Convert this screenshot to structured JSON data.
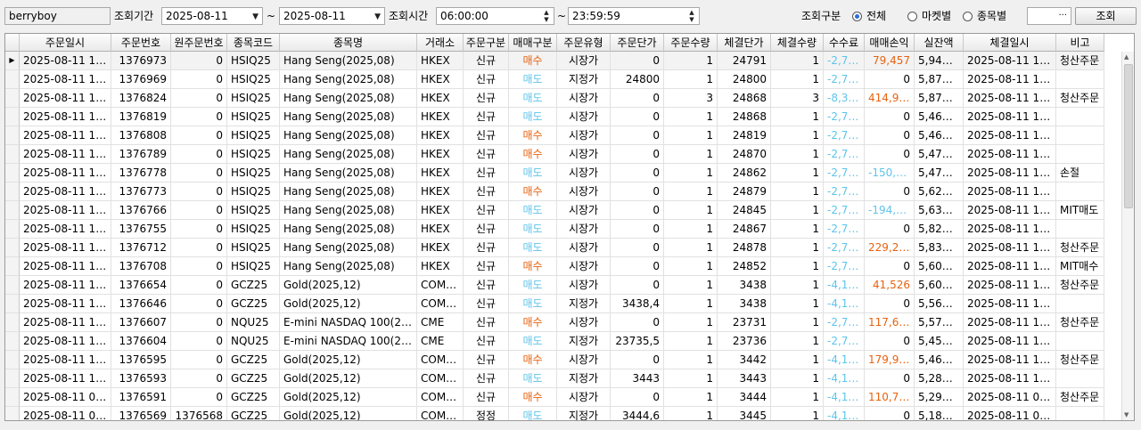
{
  "toolbar": {
    "user_id": "berryboy",
    "period_label": "조회기간",
    "date_from": "2025-08-11",
    "tilde1": "~",
    "date_to": "2025-08-11",
    "time_label": "조회시간",
    "time_from": "06:00:00",
    "tilde2": "~",
    "time_to": "23:59:59",
    "filter_label": "조회구분",
    "radio_all": "전체",
    "radio_market": "마켓별",
    "radio_symbol": "종목별",
    "ellipsis": "···",
    "search_button": "조회"
  },
  "icons": {
    "selected_row": "triangle-right-icon",
    "dropdown": "chevron-down-icon",
    "spin": "spin-updown-icon"
  },
  "colors": {
    "buy": "#e8620f",
    "sell": "#5ec4ea",
    "negative": "#5ec4ea",
    "positive": "#e8620f",
    "radio_on": "#2a6bd6"
  },
  "columns": [
    "주문일시",
    "주문번호",
    "원주문번호",
    "종목코드",
    "종목명",
    "거래소",
    "주문구분",
    "매매구분",
    "주문유형",
    "주문단가",
    "주문수량",
    "체결단가",
    "체결수량",
    "수수료",
    "매매손익",
    "실잔액",
    "체결일시",
    "비고"
  ],
  "rows": [
    [
      "2025-08-11 11:…",
      "1376973",
      "0",
      "HSIQ25",
      "Hang Seng(2025,08)",
      "HKEX",
      "신규",
      "매수",
      "시장가",
      "0",
      "1",
      "24791",
      "1",
      "-2,772",
      "79,457",
      "5,947,…",
      "2025-08-11 11:…",
      "청산주문"
    ],
    [
      "2025-08-11 11:…",
      "1376969",
      "0",
      "HSIQ25",
      "Hang Seng(2025,08)",
      "HKEX",
      "신규",
      "매도",
      "지정가",
      "24800",
      "1",
      "24800",
      "1",
      "-2,772",
      "0",
      "5,870,…",
      "2025-08-11 11:…",
      ""
    ],
    [
      "2025-08-11 10:…",
      "1376824",
      "0",
      "HSIQ25",
      "Hang Seng(2025,08)",
      "HKEX",
      "신규",
      "매도",
      "시장가",
      "0",
      "3",
      "24868",
      "3",
      "-8,316",
      "414,940",
      "5,873,…",
      "2025-08-11 10:…",
      "청산주문"
    ],
    [
      "2025-08-11 10:…",
      "1376819",
      "0",
      "HSIQ25",
      "Hang Seng(2025,08)",
      "HKEX",
      "신규",
      "매도",
      "시장가",
      "0",
      "1",
      "24868",
      "1",
      "-2,772",
      "0",
      "5,466,…",
      "2025-08-11 10:…",
      ""
    ],
    [
      "2025-08-11 10:…",
      "1376808",
      "0",
      "HSIQ25",
      "Hang Seng(2025,08)",
      "HKEX",
      "신규",
      "매수",
      "시장가",
      "0",
      "1",
      "24819",
      "1",
      "-2,772",
      "0",
      "5,469,…",
      "2025-08-11 10:…",
      ""
    ],
    [
      "2025-08-11 10:…",
      "1376789",
      "0",
      "HSIQ25",
      "Hang Seng(2025,08)",
      "HKEX",
      "신규",
      "매수",
      "시장가",
      "0",
      "1",
      "24870",
      "1",
      "-2,772",
      "0",
      "5,472,…",
      "2025-08-11 10:…",
      ""
    ],
    [
      "2025-08-11 10:…",
      "1376778",
      "0",
      "HSIQ25",
      "Hang Seng(2025,08)",
      "HKEX",
      "신규",
      "매도",
      "시장가",
      "0",
      "1",
      "24862",
      "1",
      "-2,772",
      "-150,085",
      "5,475,…",
      "2025-08-11 10:…",
      "손절"
    ],
    [
      "2025-08-11 10:…",
      "1376773",
      "0",
      "HSIQ25",
      "Hang Seng(2025,08)",
      "HKEX",
      "신규",
      "매수",
      "시장가",
      "0",
      "1",
      "24879",
      "1",
      "-2,772",
      "0",
      "5,628,…",
      "2025-08-11 10:…",
      ""
    ],
    [
      "2025-08-11 10:…",
      "1376766",
      "0",
      "HSIQ25",
      "Hang Seng(2025,08)",
      "HKEX",
      "신규",
      "매도",
      "시장가",
      "0",
      "1",
      "24845",
      "1",
      "-2,772",
      "-194,227",
      "5,630,…",
      "2025-08-11 10:…",
      "MIT매도"
    ],
    [
      "2025-08-11 10:…",
      "1376755",
      "0",
      "HSIQ25",
      "Hang Seng(2025,08)",
      "HKEX",
      "신규",
      "매도",
      "시장가",
      "0",
      "1",
      "24867",
      "1",
      "-2,772",
      "0",
      "5,827,…",
      "2025-08-11 10:…",
      ""
    ],
    [
      "2025-08-11 10:…",
      "1376712",
      "0",
      "HSIQ25",
      "Hang Seng(2025,08)",
      "HKEX",
      "신규",
      "매도",
      "시장가",
      "0",
      "1",
      "24878",
      "1",
      "-2,768",
      "229,242",
      "5,830,…",
      "2025-08-11 10:…",
      "청산주문"
    ],
    [
      "2025-08-11 10:…",
      "1376708",
      "0",
      "HSIQ25",
      "Hang Seng(2025,08)",
      "HKEX",
      "신규",
      "매수",
      "시장가",
      "0",
      "1",
      "24852",
      "1",
      "-2,768",
      "0",
      "5,604,…",
      "2025-08-11 10:…",
      "MIT매수"
    ],
    [
      "2025-08-11 10:…",
      "1376654",
      "0",
      "GCZ25",
      "Gold(2025,12)",
      "COM…",
      "신규",
      "매도",
      "시장가",
      "0",
      "1",
      "3438",
      "1",
      "-4,153",
      "41,526",
      "5,607,…",
      "2025-08-11 10:…",
      "청산주문"
    ],
    [
      "2025-08-11 10:…",
      "1376646",
      "0",
      "GCZ25",
      "Gold(2025,12)",
      "COM…",
      "신규",
      "매도",
      "지정가",
      "3438,4",
      "1",
      "3438",
      "1",
      "-4,153",
      "0",
      "5,569,…",
      "2025-08-11 10:…",
      ""
    ],
    [
      "2025-08-11 10:…",
      "1376607",
      "0",
      "NQU25",
      "E-mini NASDAQ 100(20…",
      "CME",
      "신규",
      "매수",
      "시장가",
      "0",
      "1",
      "23731",
      "1",
      "-2,768",
      "117,657",
      "5,573,…",
      "2025-08-11 10:…",
      "청산주문"
    ],
    [
      "2025-08-11 10:…",
      "1376604",
      "0",
      "NQU25",
      "E-mini NASDAQ 100(20…",
      "CME",
      "신규",
      "매도",
      "지정가",
      "23735,5",
      "1",
      "23736",
      "1",
      "-2,768",
      "0",
      "5,458,…",
      "2025-08-11 10:…",
      ""
    ],
    [
      "2025-08-11 10:…",
      "1376595",
      "0",
      "GCZ25",
      "Gold(2025,12)",
      "COM…",
      "신규",
      "매수",
      "시장가",
      "0",
      "1",
      "3442",
      "1",
      "-4,153",
      "179,946",
      "5,461,…",
      "2025-08-11 10:…",
      "청산주문"
    ],
    [
      "2025-08-11 10:…",
      "1376593",
      "0",
      "GCZ25",
      "Gold(2025,12)",
      "COM…",
      "신규",
      "매도",
      "지정가",
      "3443",
      "1",
      "3443",
      "1",
      "-4,153",
      "0",
      "5,285,…",
      "2025-08-11 10:…",
      ""
    ],
    [
      "2025-08-11 09:…",
      "1376591",
      "0",
      "GCZ25",
      "Gold(2025,12)",
      "COM…",
      "신규",
      "매수",
      "시장가",
      "0",
      "1",
      "3444",
      "1",
      "-4,153",
      "110,736",
      "5,290,…",
      "2025-08-11 09:…",
      "청산주문"
    ],
    [
      "2025-08-11 09:…",
      "1376569",
      "1376568",
      "GCZ25",
      "Gold(2025,12)",
      "COM…",
      "정정",
      "매도",
      "지정가",
      "3444,6",
      "1",
      "3445",
      "1",
      "-4,153",
      "0",
      "5,183,…",
      "2025-08-11 09:…",
      ""
    ]
  ]
}
